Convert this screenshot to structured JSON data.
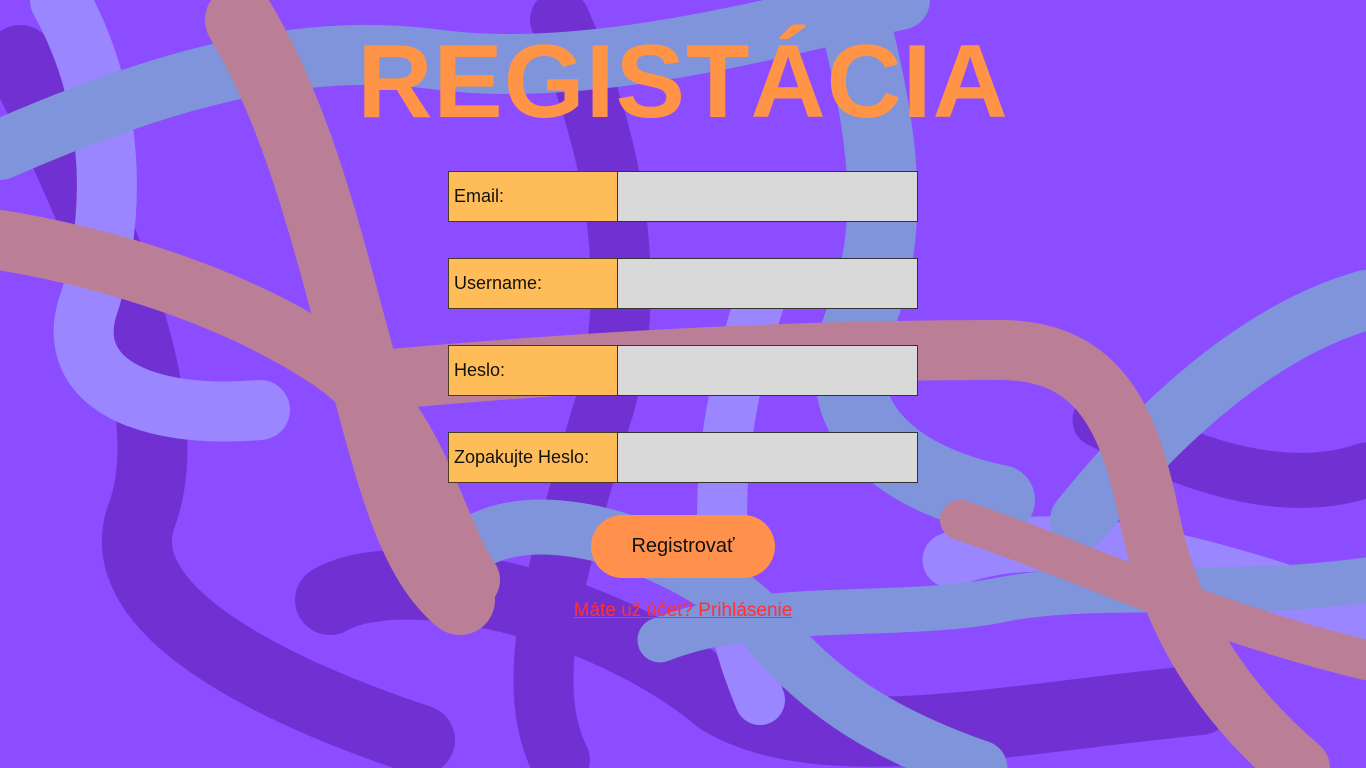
{
  "page": {
    "title": "REGISTÁCIA"
  },
  "form": {
    "fields": [
      {
        "label": "Email:",
        "value": ""
      },
      {
        "label": "Username:",
        "value": ""
      },
      {
        "label": "Heslo:",
        "value": ""
      },
      {
        "label": "Zopakujte Heslo:",
        "value": ""
      }
    ],
    "submit_label": "Registrovať"
  },
  "footer": {
    "login_link_text": "Máte už účet? Prihlásenie"
  },
  "colors": {
    "background": "#8b4dff",
    "title": "#ff9447",
    "label_background": "#ffbd59",
    "input_background": "#d9d9d9",
    "button_background": "#ff914d",
    "link": "#ff3131"
  }
}
